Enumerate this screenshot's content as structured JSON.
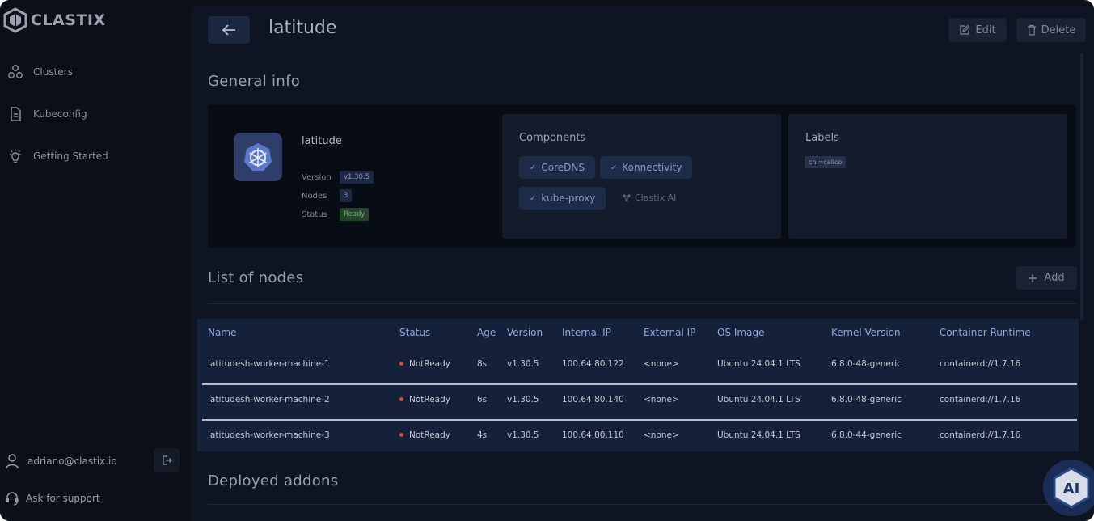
{
  "app": {
    "brand": "CLASTIX"
  },
  "sidebar": {
    "items": [
      {
        "label": "Clusters",
        "icon": "clusters-icon"
      },
      {
        "label": "Kubeconfig",
        "icon": "document-icon"
      },
      {
        "label": "Getting Started",
        "icon": "lightbulb-icon"
      }
    ],
    "user_email": "adriano@clastix.io",
    "support_label": "Ask for support"
  },
  "header": {
    "title": "latitude",
    "edit_label": "Edit",
    "delete_label": "Delete"
  },
  "general_info": {
    "section_title": "General info",
    "cluster_name": "latitude",
    "version_key": "Version",
    "version": "v1.30.5",
    "nodes_key": "Nodes",
    "nodes": "3",
    "status_key": "Status",
    "status": "Ready",
    "components_title": "Components",
    "components": [
      "CoreDNS",
      "Konnectivity",
      "kube-proxy"
    ],
    "ai_component": "Clastix AI",
    "labels_title": "Labels",
    "labels": [
      "cni=calico"
    ]
  },
  "nodes_section": {
    "title": "List of nodes",
    "add_label": "Add",
    "columns": [
      "Name",
      "Status",
      "Age",
      "Version",
      "Internal IP",
      "External IP",
      "OS Image",
      "Kernel Version",
      "Container Runtime"
    ],
    "rows": [
      {
        "name": "latitudesh-worker-machine-1",
        "status": "NotReady",
        "age": "8s",
        "version": "v1.30.5",
        "internal_ip": "100.64.80.122",
        "external_ip": "<none>",
        "os_image": "Ubuntu 24.04.1 LTS",
        "kernel": "6.8.0-48-generic",
        "runtime": "containerd://1.7.16"
      },
      {
        "name": "latitudesh-worker-machine-2",
        "status": "NotReady",
        "age": "6s",
        "version": "v1.30.5",
        "internal_ip": "100.64.80.140",
        "external_ip": "<none>",
        "os_image": "Ubuntu 24.04.1 LTS",
        "kernel": "6.8.0-48-generic",
        "runtime": "containerd://1.7.16"
      },
      {
        "name": "latitudesh-worker-machine-3",
        "status": "NotReady",
        "age": "4s",
        "version": "v1.30.5",
        "internal_ip": "100.64.80.110",
        "external_ip": "<none>",
        "os_image": "Ubuntu 24.04.1 LTS",
        "kernel": "6.8.0-44-generic",
        "runtime": "containerd://1.7.16"
      }
    ]
  },
  "addons_section": {
    "title": "Deployed addons"
  },
  "ai_button": {
    "label": "AI"
  },
  "colors": {
    "accent": "#1c2841",
    "status_ready": "#74a877",
    "status_notready": "#d9443a",
    "table_bg": "#15213a"
  }
}
